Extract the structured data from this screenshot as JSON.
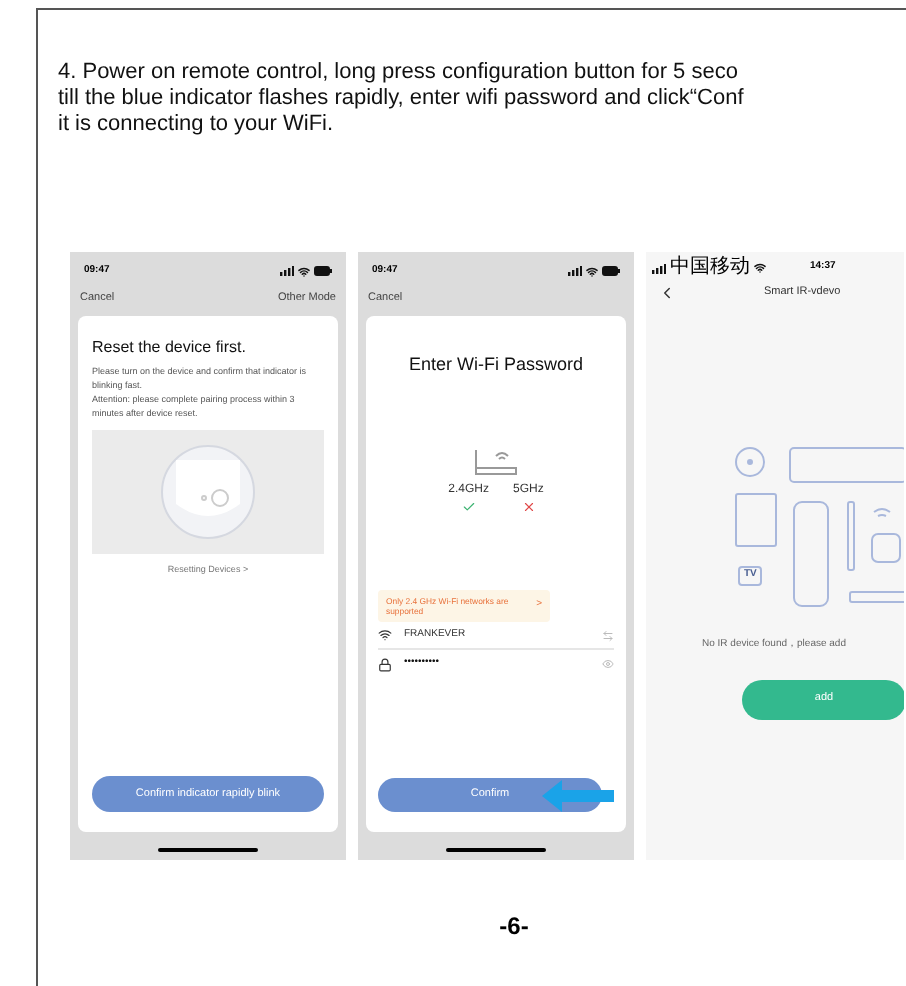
{
  "paragraph_lines": [
    "4. Power on remote control, long press configuration button for 5 seco",
    "till the blue indicator flashes rapidly, enter wifi password and click“Conf",
    "it is connecting to your WiFi."
  ],
  "phones": [
    {
      "kind": "reset",
      "status_time": "09:47",
      "nav_left": "Cancel",
      "nav_right": "Other Mode",
      "title": "Reset the device first.",
      "body_lines": [
        "Please turn on the device and confirm that indicator is blinking fast.",
        "Attention: please complete pairing process within 3 minutes after device reset."
      ],
      "link": "Resetting Devices >",
      "button": "Confirm indicator rapidly blink"
    },
    {
      "kind": "wifi",
      "status_time": "09:47",
      "nav_left": "Cancel",
      "title": "Enter Wi-Fi Password",
      "bands": [
        {
          "label": "2.4GHz",
          "supported": true
        },
        {
          "label": "5GHz",
          "supported": false
        }
      ],
      "notice": "Only 2.4 GHz Wi-Fi networks are supported",
      "notice_arrow": ">",
      "ssid": "FRANKEVER",
      "password": "••••••••••",
      "button": "Confirm"
    },
    {
      "kind": "ir",
      "carrier": "中国移动",
      "status_time": "14:37",
      "title": "Smart IR-vdevo",
      "tv_label": "TV",
      "message": "No IR device found，please add",
      "button": "add"
    }
  ],
  "page_number": "-6-"
}
